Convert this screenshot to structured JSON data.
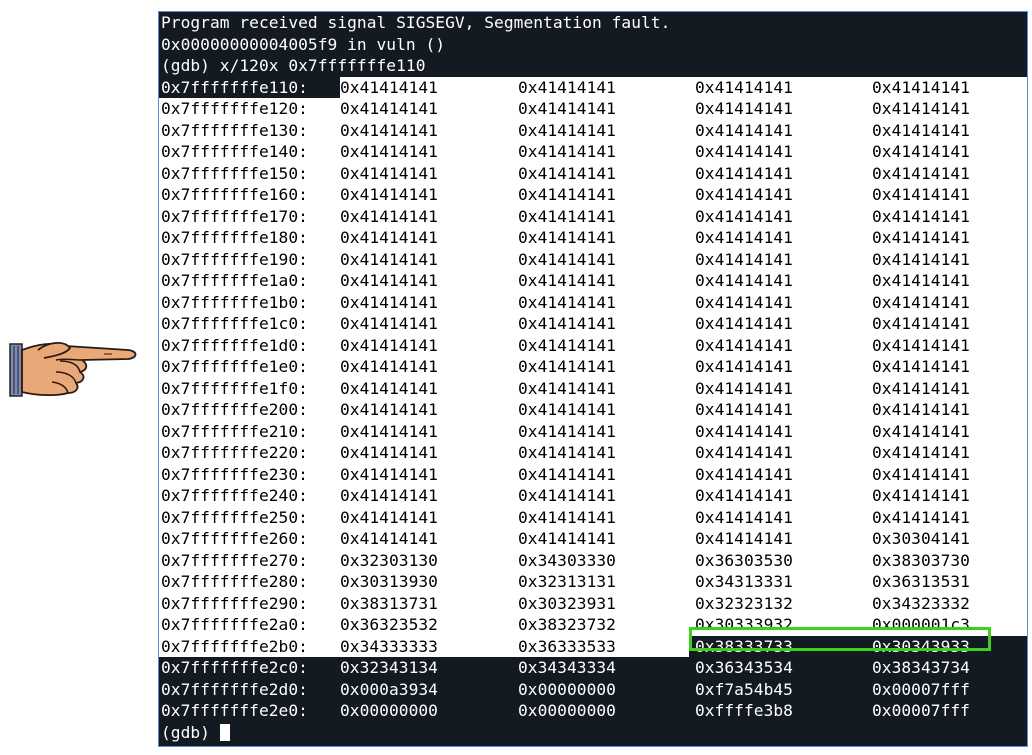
{
  "header_lines": [
    "Program received signal SIGSEGV, Segmentation fault.",
    "0x00000000004005f9 in vuln ()",
    "(gdb) x/120x 0x7fffffffe110"
  ],
  "prompt": "(gdb) ",
  "memory_rows": [
    {
      "addr": "0x7fffffffe110:",
      "cells": [
        "0x41414141",
        "0x41414141",
        "0x41414141",
        "0x41414141"
      ]
    },
    {
      "addr": "0x7fffffffe120:",
      "cells": [
        "0x41414141",
        "0x41414141",
        "0x41414141",
        "0x41414141"
      ]
    },
    {
      "addr": "0x7fffffffe130:",
      "cells": [
        "0x41414141",
        "0x41414141",
        "0x41414141",
        "0x41414141"
      ]
    },
    {
      "addr": "0x7fffffffe140:",
      "cells": [
        "0x41414141",
        "0x41414141",
        "0x41414141",
        "0x41414141"
      ]
    },
    {
      "addr": "0x7fffffffe150:",
      "cells": [
        "0x41414141",
        "0x41414141",
        "0x41414141",
        "0x41414141"
      ]
    },
    {
      "addr": "0x7fffffffe160:",
      "cells": [
        "0x41414141",
        "0x41414141",
        "0x41414141",
        "0x41414141"
      ]
    },
    {
      "addr": "0x7fffffffe170:",
      "cells": [
        "0x41414141",
        "0x41414141",
        "0x41414141",
        "0x41414141"
      ]
    },
    {
      "addr": "0x7fffffffe180:",
      "cells": [
        "0x41414141",
        "0x41414141",
        "0x41414141",
        "0x41414141"
      ]
    },
    {
      "addr": "0x7fffffffe190:",
      "cells": [
        "0x41414141",
        "0x41414141",
        "0x41414141",
        "0x41414141"
      ]
    },
    {
      "addr": "0x7fffffffe1a0:",
      "cells": [
        "0x41414141",
        "0x41414141",
        "0x41414141",
        "0x41414141"
      ]
    },
    {
      "addr": "0x7fffffffe1b0:",
      "cells": [
        "0x41414141",
        "0x41414141",
        "0x41414141",
        "0x41414141"
      ]
    },
    {
      "addr": "0x7fffffffe1c0:",
      "cells": [
        "0x41414141",
        "0x41414141",
        "0x41414141",
        "0x41414141"
      ]
    },
    {
      "addr": "0x7fffffffe1d0:",
      "cells": [
        "0x41414141",
        "0x41414141",
        "0x41414141",
        "0x41414141"
      ]
    },
    {
      "addr": "0x7fffffffe1e0:",
      "cells": [
        "0x41414141",
        "0x41414141",
        "0x41414141",
        "0x41414141"
      ]
    },
    {
      "addr": "0x7fffffffe1f0:",
      "cells": [
        "0x41414141",
        "0x41414141",
        "0x41414141",
        "0x41414141"
      ]
    },
    {
      "addr": "0x7fffffffe200:",
      "cells": [
        "0x41414141",
        "0x41414141",
        "0x41414141",
        "0x41414141"
      ]
    },
    {
      "addr": "0x7fffffffe210:",
      "cells": [
        "0x41414141",
        "0x41414141",
        "0x41414141",
        "0x41414141"
      ]
    },
    {
      "addr": "0x7fffffffe220:",
      "cells": [
        "0x41414141",
        "0x41414141",
        "0x41414141",
        "0x41414141"
      ]
    },
    {
      "addr": "0x7fffffffe230:",
      "cells": [
        "0x41414141",
        "0x41414141",
        "0x41414141",
        "0x41414141"
      ]
    },
    {
      "addr": "0x7fffffffe240:",
      "cells": [
        "0x41414141",
        "0x41414141",
        "0x41414141",
        "0x41414141"
      ]
    },
    {
      "addr": "0x7fffffffe250:",
      "cells": [
        "0x41414141",
        "0x41414141",
        "0x41414141",
        "0x41414141"
      ]
    },
    {
      "addr": "0x7fffffffe260:",
      "cells": [
        "0x41414141",
        "0x41414141",
        "0x41414141",
        "0x30304141"
      ]
    },
    {
      "addr": "0x7fffffffe270:",
      "cells": [
        "0x32303130",
        "0x34303330",
        "0x36303530",
        "0x38303730"
      ]
    },
    {
      "addr": "0x7fffffffe280:",
      "cells": [
        "0x30313930",
        "0x32313131",
        "0x34313331",
        "0x36313531"
      ]
    },
    {
      "addr": "0x7fffffffe290:",
      "cells": [
        "0x38313731",
        "0x30323931",
        "0x32323132",
        "0x34323332"
      ]
    },
    {
      "addr": "0x7fffffffe2a0:",
      "cells": [
        "0x36323532",
        "0x38323732",
        "0x30333932",
        "0x000001c3"
      ]
    },
    {
      "addr": "0x7fffffffe2b0:",
      "cells": [
        "0x34333333",
        "0x36333533",
        "0x38333733",
        "0x30343933"
      ]
    },
    {
      "addr": "0x7fffffffe2c0:",
      "cells": [
        "0x32343134",
        "0x34343334",
        "0x36343534",
        "0x38343734"
      ]
    },
    {
      "addr": "0x7fffffffe2d0:",
      "cells": [
        "0x000a3934",
        "0x00000000",
        "0xf7a54b45",
        "0x00007fff"
      ]
    },
    {
      "addr": "0x7fffffffe2e0:",
      "cells": [
        "0x00000000",
        "0x00000000",
        "0xffffe3b8",
        "0x00007fff"
      ]
    }
  ],
  "colors": {
    "terminal_bg": "#141a22",
    "selection_bg": "#ffffff",
    "highlight_border": "#3ccf1e"
  },
  "icons": {
    "pointer": "pointing-hand-icon"
  }
}
